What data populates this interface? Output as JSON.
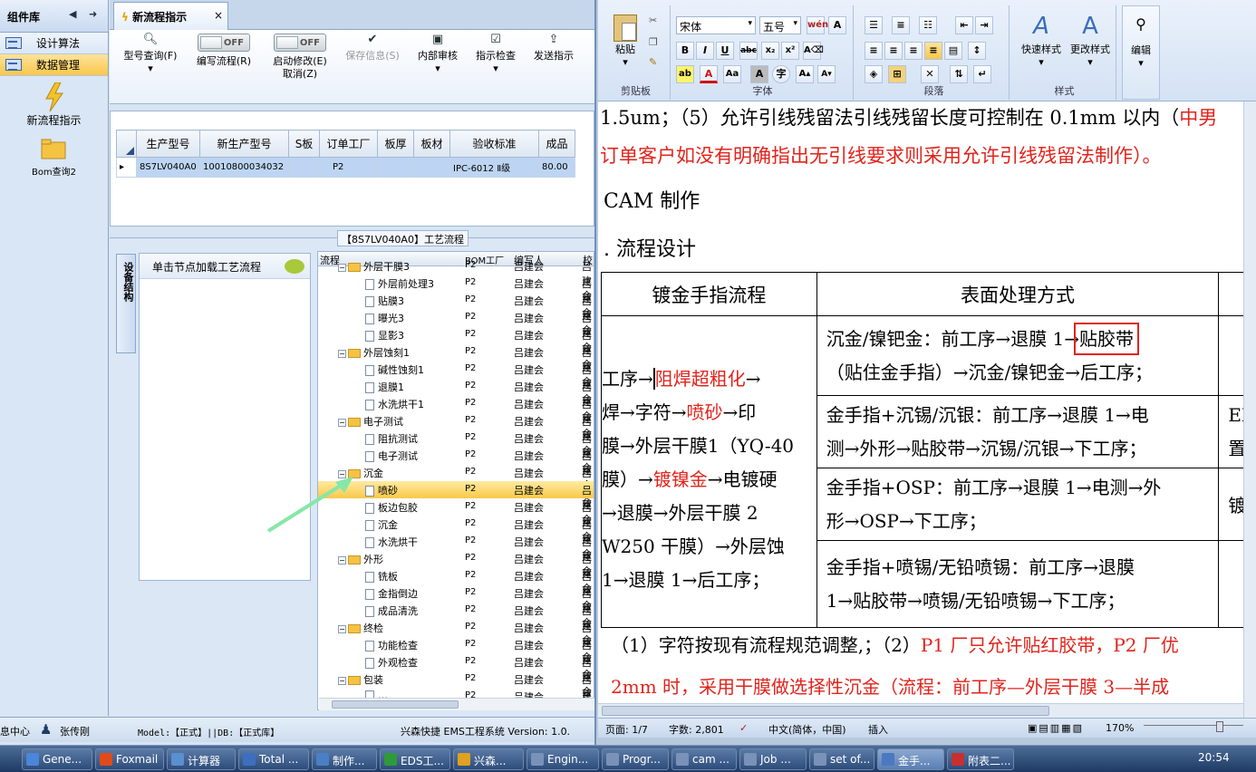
{
  "left_panel": {
    "title": "组件库",
    "items": [
      {
        "label": "设计算法"
      },
      {
        "label": "数据管理"
      }
    ],
    "new_flow_label": "新流程指示",
    "bom_label": "Bom查询2"
  },
  "tab": {
    "title": "新流程指示",
    "close": "×"
  },
  "toolbar": {
    "model_query": "型号查询(F)",
    "write_flow": "编写流程(R)",
    "auto_modify": "启动修改(E)",
    "cancel": "取消(Z)",
    "save_info": "保存信息(S)",
    "internal_review": "内部审核",
    "instruction_check": "指示检查",
    "send_instruction": "发送指示",
    "toggle_off": "OFF"
  },
  "grid": {
    "headers": [
      "生产型号",
      "新生产型号",
      "S板",
      "订单工厂",
      "板厚",
      "板材",
      "验收标准",
      "成品"
    ],
    "row": [
      "8S7LV040A0",
      "10010800034032",
      "",
      "P2",
      "",
      "",
      "IPC-6012 Ⅱ级",
      "80.00"
    ]
  },
  "process_title": "【8S7LV040A0】工艺流程",
  "side_tab": "设备结构",
  "node_panel": {
    "header": "单击节点加载工艺流程"
  },
  "tree": {
    "headers": {
      "flow": "流程",
      "bom": "BOM工厂",
      "writer": "编写人",
      "r": "校"
    },
    "rows": [
      {
        "label": "外层干膜3",
        "type": "folder",
        "bom": "P2",
        "writer": "吕建会"
      },
      {
        "label": "外层前处理3",
        "type": "doc",
        "bom": "P2",
        "writer": "吕建会"
      },
      {
        "label": "贴膜3",
        "type": "doc",
        "bom": "P2",
        "writer": "吕建会"
      },
      {
        "label": "曝光3",
        "type": "doc",
        "bom": "P2",
        "writer": "吕建会"
      },
      {
        "label": "显影3",
        "type": "doc",
        "bom": "P2",
        "writer": "吕建会"
      },
      {
        "label": "外层蚀刻1",
        "type": "folder",
        "bom": "P2",
        "writer": "吕建会"
      },
      {
        "label": "碱性蚀刻1",
        "type": "doc",
        "bom": "P2",
        "writer": "吕建会"
      },
      {
        "label": "退膜1",
        "type": "doc",
        "bom": "P2",
        "writer": "吕建会"
      },
      {
        "label": "水洗烘干1",
        "type": "doc",
        "bom": "P2",
        "writer": "吕建会"
      },
      {
        "label": "电子测试",
        "type": "folder",
        "bom": "P2",
        "writer": "吕建会"
      },
      {
        "label": "阻抗测试",
        "type": "doc",
        "bom": "P2",
        "writer": "吕建会"
      },
      {
        "label": "电子测试",
        "type": "doc",
        "bom": "P2",
        "writer": "吕建会"
      },
      {
        "label": "沉金",
        "type": "folder",
        "bom": "P2",
        "writer": "吕建会"
      },
      {
        "label": "喷砂",
        "type": "doc",
        "bom": "P2",
        "writer": "吕建会",
        "sel": true
      },
      {
        "label": "板边包胶",
        "type": "doc",
        "bom": "P2",
        "writer": "吕建会"
      },
      {
        "label": "沉金",
        "type": "doc",
        "bom": "P2",
        "writer": "吕建会"
      },
      {
        "label": "水洗烘干",
        "type": "doc",
        "bom": "P2",
        "writer": "吕建会"
      },
      {
        "label": "外形",
        "type": "folder",
        "bom": "P2",
        "writer": "吕建会"
      },
      {
        "label": "铣板",
        "type": "doc",
        "bom": "P2",
        "writer": "吕建会"
      },
      {
        "label": "金指倒边",
        "type": "doc",
        "bom": "P2",
        "writer": "吕建会"
      },
      {
        "label": "成品清洗",
        "type": "doc",
        "bom": "P2",
        "writer": "吕建会"
      },
      {
        "label": "终检",
        "type": "folder",
        "bom": "P2",
        "writer": "吕建会"
      },
      {
        "label": "功能检查",
        "type": "doc",
        "bom": "P2",
        "writer": "吕建会"
      },
      {
        "label": "外观检查",
        "type": "doc",
        "bom": "P2",
        "writer": "吕建会"
      },
      {
        "label": "包装",
        "type": "folder",
        "bom": "P2",
        "writer": "吕建会"
      },
      {
        "label": "…",
        "type": "doc",
        "bom": "P2",
        "writer": "吕建会"
      }
    ]
  },
  "statusbar": {
    "center": "息中心",
    "user": "张传刚",
    "model": "Model:【正式】||DB:【正式库】",
    "app": "兴森快捷 EMS工程系统 Version: 1.0."
  },
  "word": {
    "ribbon": {
      "paste": "粘贴",
      "clipboard": "剪贴板",
      "font_name": "宋体",
      "font_size": "五号",
      "font": "字体",
      "paragraph": "段落",
      "quick_style": "快速样式",
      "change_style": "更改样式",
      "styles": "样式",
      "edit": "编辑"
    },
    "lines": {
      "l1a": "1.5um；（5）允许引线残留法引线残留长度可控制在 0.1mm 以内（",
      "l1b": "中男",
      "l2": "订单客户如没有明确指出无引线要求则采用允许引线残留法制作）。",
      "l3": "CAM 制作",
      "l4": ". 流程设计"
    },
    "table": {
      "h1": "镀金手指流程",
      "h2": "表面处理方式",
      "c1": [
        "工序→",
        "阻焊超粗化",
        "→",
        "焊→字符→",
        "喷砂",
        "→印",
        "膜→外层干膜1（YQ-40",
        "膜）→",
        "镀镍金",
        "→电镀硬",
        "→退膜→外层干膜 2",
        "W250 干膜）→外层蚀",
        "1→退膜 1→后工序；"
      ],
      "r1": [
        "沉金/镍钯金：前工序→退膜 1→",
        "贴胶带",
        "（贴住金手指）→沉金/镍钯金→后工序；"
      ],
      "r2": [
        "金手指+沉锡/沉银：前工序→退膜 1→电",
        "测→外形→贴胶带→沉锡/沉银→下工序；"
      ],
      "r3": [
        "金手指+OSP：前工序→退膜 1→电测→外",
        "形→OSP→下工序；"
      ],
      "r4": [
        "金手指+喷锡/无铅喷锡：前工序→退膜",
        "1→贴胶带→喷锡/无铅喷锡→下工序；"
      ],
      "side": [
        "ER",
        "置",
        "镀"
      ]
    },
    "tail1a": "（1）字符按现有流程规范调整,；（2）",
    "tail1b": "P1 厂只允许贴红胶带，P2 厂优",
    "tail2": "2mm 时，采用干膜做选择性沉金（流程：前工序—外层干膜 3—半成",
    "status": {
      "page": "页面: 1/7",
      "words": "字数: 2,801",
      "lang": "中文(简体，中国)",
      "insert": "插入",
      "zoom": "170%"
    }
  },
  "taskbar": {
    "items": [
      "Gene...",
      "Foxmail",
      "计算器",
      "Total ...",
      "制作...",
      "EDS工...",
      "兴森...",
      "Engin...",
      "Progr...",
      "cam ...",
      "Job ...",
      "set of...",
      "金手...",
      "附表二..."
    ],
    "time": "20:54"
  }
}
